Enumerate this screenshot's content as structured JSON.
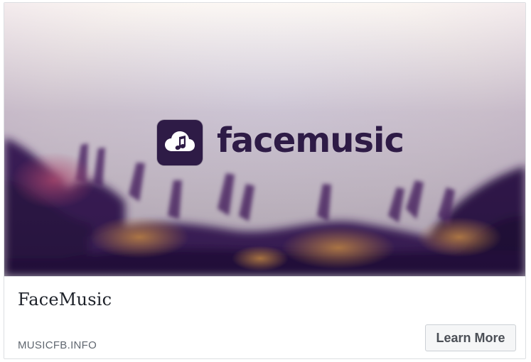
{
  "ad": {
    "brand_name": "facemusic",
    "brand_icon": "cloud-music-note-icon",
    "title": "FaceMusic",
    "domain": "MUSICFB.INFO",
    "cta_label": "Learn More"
  },
  "colors": {
    "brand_purple": "#2e1b46",
    "title_text": "#1d2129",
    "domain_text": "#606770",
    "button_bg": "#f5f6f7",
    "button_border": "#ccd0d5"
  }
}
